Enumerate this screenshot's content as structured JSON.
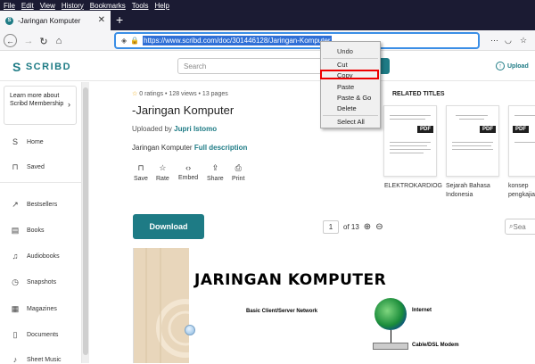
{
  "menubar": {
    "items": [
      "File",
      "Edit",
      "View",
      "History",
      "Bookmarks",
      "Tools",
      "Help"
    ]
  },
  "tab": {
    "title": "-Jaringan Komputer",
    "favicon": "S",
    "close": "✕",
    "new_tab": "+"
  },
  "nav": {
    "url": "https://www.scribd.com/doc/301446128/Jaringan-Komputer"
  },
  "context_menu": {
    "items": [
      "Undo",
      "Cut",
      "Copy",
      "Paste",
      "Paste & Go",
      "Delete",
      "Select All"
    ],
    "highlighted": "Copy"
  },
  "header": {
    "logo": "SCRIBD",
    "search_placeholder": "Search",
    "upload": "Upload"
  },
  "sidebar": {
    "membership": "Learn more about Scribd Membership",
    "items": [
      "Home",
      "Saved",
      "Bestsellers",
      "Books",
      "Audiobooks",
      "Snapshots",
      "Magazines",
      "Documents",
      "Sheet Music"
    ]
  },
  "doc": {
    "ratings": "0 ratings",
    "views": "128 views",
    "pages": "13 pages",
    "title": "-Jaringan Komputer",
    "uploaded_prefix": "Uploaded by",
    "author": "Jupri Istomo",
    "desc_text": "Jaringan Komputer",
    "desc_link": "Full description",
    "actions": [
      "Save",
      "Rate",
      "Embed",
      "Share",
      "Print"
    ],
    "download": "Download",
    "page_current": "1",
    "page_of": "of 13",
    "search_doc": "Sea"
  },
  "related": {
    "header": "RELATED TITLES",
    "items": [
      {
        "title": "ELEKTROKARDIOG",
        "badge": ""
      },
      {
        "title": "Sejarah Bahasa Indonesia",
        "badge": "PDF"
      },
      {
        "title": "konsep pengkajia",
        "badge": "PDF"
      }
    ],
    "first_badge": "PDF"
  },
  "preview": {
    "heading": "JARINGAN KOMPUTER",
    "subtitle": "Basic Client/Server Network",
    "internet": "Internet",
    "modem": "Cable/DSL Modem"
  },
  "colors": {
    "brand": "#1e7b85",
    "menubar": "#1b1b33",
    "url_highlight": "#2f6fd6",
    "copy_box": "#e00000"
  }
}
